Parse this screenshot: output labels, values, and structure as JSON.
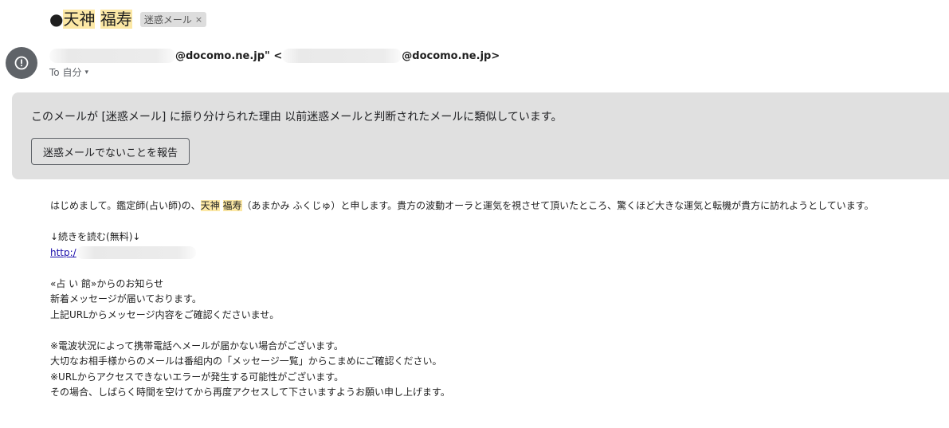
{
  "subject": {
    "bullet": "●",
    "name_part1": "天神",
    "name_part2": "福寿",
    "label": "迷惑メール",
    "label_close": "×"
  },
  "sender": {
    "from_suffix": "@docomo.ne.jp\" <",
    "email_suffix": "@docomo.ne.jp>",
    "to_text": "To 自分",
    "caret": "▾"
  },
  "spam_notice": {
    "reason": "このメールが [迷惑メール] に振り分けられた理由 以前迷惑メールと判断されたメールに類似しています。",
    "report_button": "迷惑メールでないことを報告"
  },
  "body": {
    "intro_before": "はじめまして。鑑定師(占い師)の、",
    "intro_name1": "天神",
    "intro_name2": "福寿",
    "intro_after": "（あまかみ ふくじゅ）と申します。貴方の波動オーラと運気を視させて頂いたところ、驚くほど大きな運気と転機が貴方に訪れようとしています。",
    "read_more": "↓続きを読む(無料)↓",
    "link_text": "http:/",
    "notice_lines": [
      "«占 い 館»からのお知らせ",
      "新着メッセージが届いております。",
      "上記URLからメッセージ内容をご確認くださいませ。"
    ],
    "warning_lines": [
      "※電波状況によって携帯電話へメールが届かない場合がございます。",
      "大切なお相手様からのメールは番組内の「メッセージ一覧」からこまめにご確認ください。",
      "※URLからアクセスできないエラーが発生する可能性がございます。",
      "その場合、しばらく時間を空けてから再度アクセスして下さいますようお願い申し上げます。"
    ]
  },
  "icons": {
    "avatar": "alert-circle-icon"
  },
  "colors": {
    "highlight": "#fce8a5",
    "spam_box": "#e0e0e0",
    "avatar": "#5f6368",
    "link": "#1a0dab"
  }
}
